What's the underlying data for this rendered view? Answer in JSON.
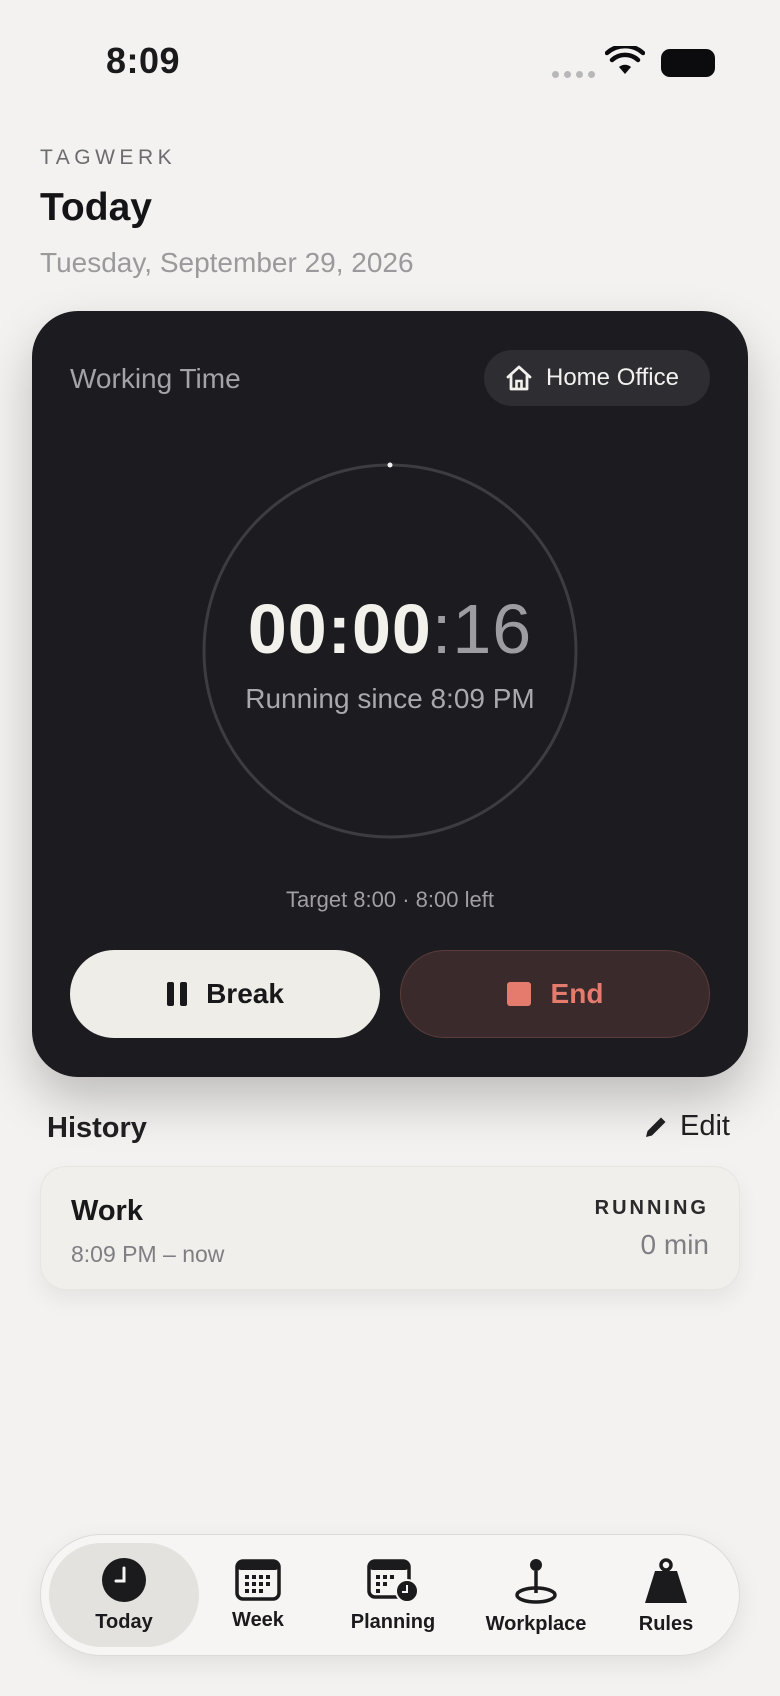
{
  "status_bar": {
    "time": "8:09"
  },
  "header": {
    "brand": "TAGWERK",
    "title": "Today",
    "date": "Tuesday, September 29, 2026"
  },
  "timer_card": {
    "label": "Working Time",
    "location": "Home Office",
    "elapsed_main": "00:00",
    "elapsed_separator": ":",
    "elapsed_seconds": "16",
    "running_since": "Running since 8:09 PM",
    "target_text": "Target 8:00 · 8:00 left",
    "break_label": "Break",
    "end_label": "End"
  },
  "history": {
    "title": "History",
    "edit_label": "Edit",
    "rows": [
      {
        "type": "Work",
        "range": "8:09 PM – now",
        "status": "RUNNING",
        "duration": "0 min"
      }
    ]
  },
  "tabbar": {
    "items": [
      {
        "label": "Today",
        "icon": "clock-icon",
        "active": true
      },
      {
        "label": "Week",
        "icon": "calendar-grid-icon",
        "active": false
      },
      {
        "label": "Planning",
        "icon": "calendar-clock-icon",
        "active": false
      },
      {
        "label": "Workplace",
        "icon": "map-pin-icon",
        "active": false
      },
      {
        "label": "Rules",
        "icon": "weight-icon",
        "active": false
      }
    ]
  },
  "colors": {
    "background": "#f3f2f0",
    "card": "#1c1b1f",
    "end_accent": "#e57b6d"
  }
}
